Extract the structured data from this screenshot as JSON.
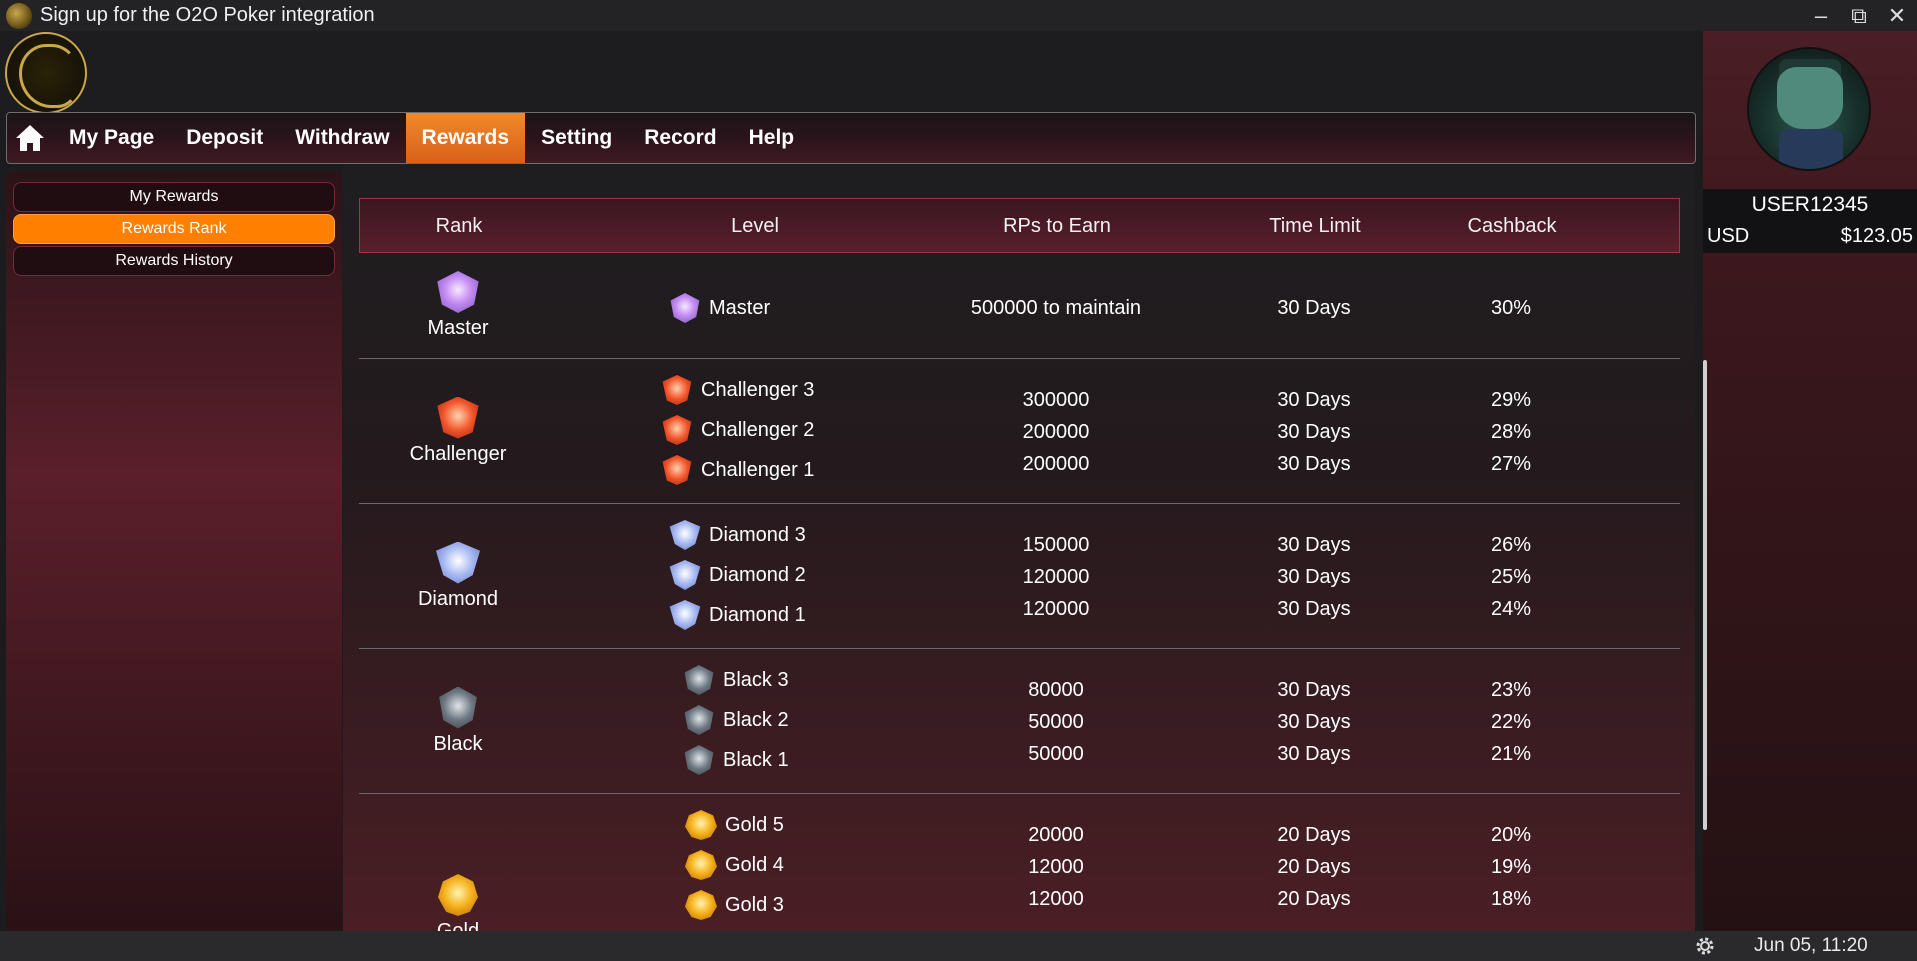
{
  "window": {
    "title": "Sign up for the O2O Poker integration"
  },
  "nav": {
    "items": [
      {
        "label": "My Page"
      },
      {
        "label": "Deposit"
      },
      {
        "label": "Withdraw"
      },
      {
        "label": "Rewards",
        "active": true
      },
      {
        "label": "Setting"
      },
      {
        "label": "Record"
      },
      {
        "label": "Help"
      }
    ]
  },
  "sidebar": {
    "items": [
      {
        "label": "My Rewards"
      },
      {
        "label": "Rewards Rank",
        "active": true
      },
      {
        "label": "Rewards History"
      }
    ]
  },
  "table": {
    "headers": [
      "Rank",
      "Level",
      "RPs to Earn",
      "Time Limit",
      "Cashback"
    ],
    "groups": [
      {
        "rank": "Master",
        "rows": [
          {
            "level": "Master",
            "rps": "500000 to maintain",
            "time": "30 Days",
            "cashback": "30%"
          }
        ]
      },
      {
        "rank": "Challenger",
        "rows": [
          {
            "level": "Challenger 3",
            "rps": "300000",
            "time": "30 Days",
            "cashback": "29%"
          },
          {
            "level": "Challenger 2",
            "rps": "200000",
            "time": "30 Days",
            "cashback": "28%"
          },
          {
            "level": "Challenger 1",
            "rps": "200000",
            "time": "30 Days",
            "cashback": "27%"
          }
        ]
      },
      {
        "rank": "Diamond",
        "rows": [
          {
            "level": "Diamond 3",
            "rps": "150000",
            "time": "30 Days",
            "cashback": "26%"
          },
          {
            "level": "Diamond 2",
            "rps": "120000",
            "time": "30 Days",
            "cashback": "25%"
          },
          {
            "level": "Diamond 1",
            "rps": "120000",
            "time": "30 Days",
            "cashback": "24%"
          }
        ]
      },
      {
        "rank": "Black",
        "rows": [
          {
            "level": "Black 3",
            "rps": "80000",
            "time": "30 Days",
            "cashback": "23%"
          },
          {
            "level": "Black 2",
            "rps": "50000",
            "time": "30 Days",
            "cashback": "22%"
          },
          {
            "level": "Black 1",
            "rps": "50000",
            "time": "30 Days",
            "cashback": "21%"
          }
        ]
      },
      {
        "rank": "Gold",
        "rows": [
          {
            "level": "Gold 5",
            "rps": "20000",
            "time": "20 Days",
            "cashback": "20%"
          },
          {
            "level": "Gold 4",
            "rps": "12000",
            "time": "20 Days",
            "cashback": "19%"
          },
          {
            "level": "Gold 3",
            "rps": "12000",
            "time": "20 Days",
            "cashback": "18%"
          }
        ]
      }
    ]
  },
  "user": {
    "name": "USER12345",
    "currency": "USD",
    "balance": "$123.05"
  },
  "status": {
    "datetime": "Jun 05, 11:20"
  },
  "icons": {
    "home": "home-icon",
    "settings": "gear-icon",
    "minimize": "minimize-icon",
    "restore": "restore-icon",
    "close": "close-icon"
  },
  "colors": {
    "accent": "#ff7f00",
    "nav_active": "#e8701f",
    "border": "#9a3a48"
  }
}
